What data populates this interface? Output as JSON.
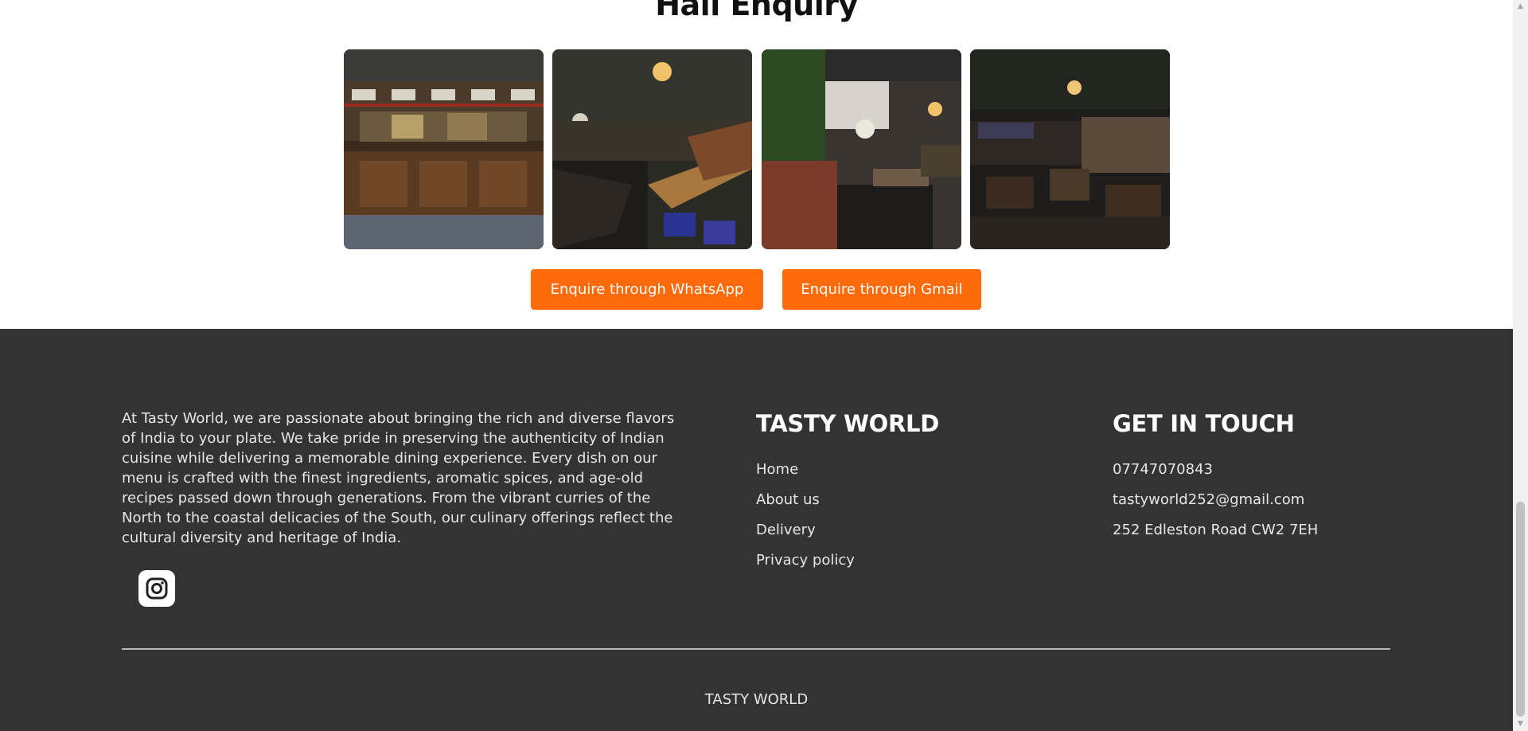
{
  "hall": {
    "title": "Hall Enquiry",
    "photos": [
      {
        "icon": "bar-counter-photo"
      },
      {
        "icon": "dining-booths-photo"
      },
      {
        "icon": "plant-wall-dining-photo"
      },
      {
        "icon": "dark-dining-room-photo"
      }
    ],
    "whatsapp_label": "Enquire through WhatsApp",
    "gmail_label": "Enquire through Gmail",
    "accent_color": "#ff6a0a"
  },
  "footer": {
    "about": "At Tasty World, we are passionate about bringing the rich and diverse flavors of India to your plate. We take pride in preserving the authenticity of Indian cuisine while delivering a memorable dining experience. Every dish on our menu is crafted with the finest ingredients, aromatic spices, and age-old recipes passed down through generations. From the vibrant curries of the North to the coastal delicacies of the South, our culinary offerings reflect the cultural diversity and heritage of India.",
    "social_icon": "instagram-icon",
    "brand_title": "TASTY WORLD",
    "links": [
      "Home",
      "About us",
      "Delivery",
      "Privacy policy"
    ],
    "contact_title": "GET IN TOUCH",
    "contact": {
      "phone": "07747070843",
      "email": "tastyworld252@gmail.com",
      "address": "252 Edleston Road CW2 7EH"
    },
    "copyright": "TASTY WORLD",
    "background_color": "#333333"
  }
}
